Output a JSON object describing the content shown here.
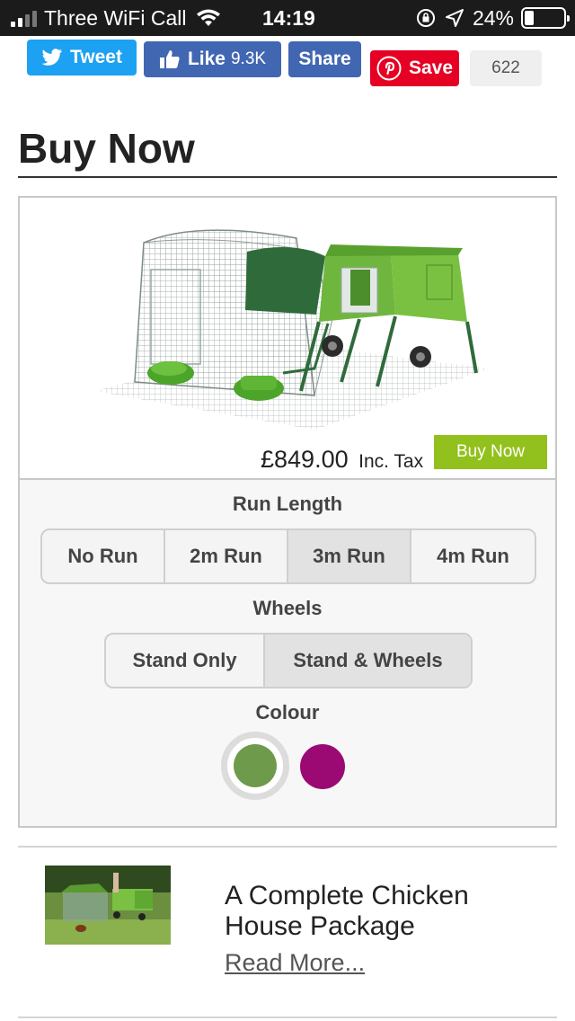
{
  "status_bar": {
    "carrier": "Three WiFi Call",
    "time": "14:19",
    "battery_percent": "24%",
    "battery_level": 0.24,
    "icons": [
      "signal-icon",
      "wifi-icon",
      "rotation-lock-icon",
      "location-icon",
      "battery-icon"
    ]
  },
  "share_bar": {
    "tweet_label": "Tweet",
    "like_label": "Like",
    "like_count": "9.3K",
    "share_label": "Share",
    "save_label": "Save",
    "save_count": "622"
  },
  "section": {
    "title": "Buy Now"
  },
  "product": {
    "price": "£849.00",
    "price_suffix": "Inc. Tax",
    "buy_label": "Buy Now",
    "run_length_label": "Run Length",
    "run_options": [
      "No Run",
      "2m Run",
      "3m Run",
      "4m Run"
    ],
    "run_selected": "3m Run",
    "wheels_label": "Wheels",
    "wheel_options": [
      "Stand Only",
      "Stand & Wheels"
    ],
    "wheel_selected": "Stand & Wheels",
    "colour_label": "Colour",
    "colours": [
      {
        "name": "green",
        "hex": "#6e9a4c",
        "selected": true
      },
      {
        "name": "purple",
        "hex": "#9b0a73",
        "selected": false
      }
    ]
  },
  "package": {
    "title": "A Complete Chicken House Package",
    "read_more": "Read More..."
  },
  "colors": {
    "twitter": "#1da1f2",
    "facebook": "#4267b2",
    "pinterest": "#e60023",
    "buy_button": "#92c01c"
  }
}
